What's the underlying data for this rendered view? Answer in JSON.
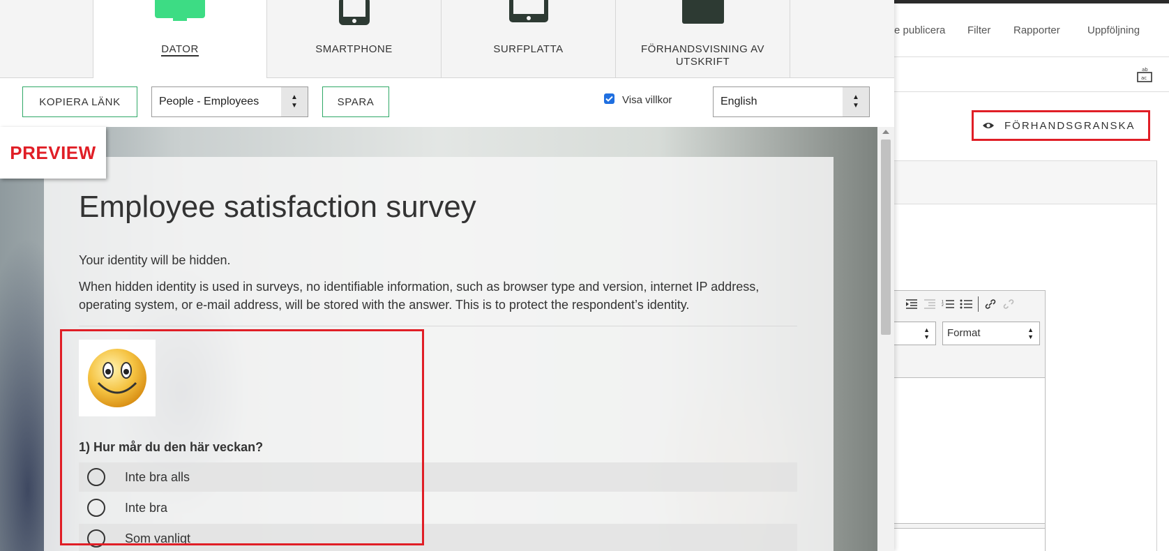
{
  "background_app": {
    "nav": [
      "e publicera",
      "Filter",
      "Rapporter",
      "Uppföljning"
    ],
    "preview_button": {
      "label": "FÖRHANDSGRANSKA",
      "icon": "eye-icon"
    },
    "editor": {
      "format_select": "Format"
    }
  },
  "device_tabs": [
    {
      "label": "DATOR",
      "icon": "desktop-icon",
      "active": true
    },
    {
      "label": "SMARTPHONE",
      "icon": "smartphone-icon",
      "active": false
    },
    {
      "label": "SURFPLATTA",
      "icon": "tablet-icon",
      "active": false
    },
    {
      "label": "FÖRHANDSVISNING AV UTSKRIFT",
      "icon": "print-icon",
      "active": false
    }
  ],
  "toolbar": {
    "copy_link": "KOPIERA LÄNK",
    "audience_select": "People - Employees",
    "save": "SPARA",
    "show_terms": {
      "label": "Visa villkor",
      "checked": true
    },
    "language_select": "English"
  },
  "preview_badge": "PREVIEW",
  "survey": {
    "title": "Employee satisfaction survey",
    "intro_line": "Your identity will be hidden.",
    "intro_paragraph": "When hidden identity is used in surveys, no identifiable information, such as browser type and version, internet IP address, operating system, or e-mail address, will be stored with the answer. This is to protect the respondent’s identity.",
    "image": "smiley-face-image",
    "question": "1) Hur mår du den här veckan?",
    "options": [
      "Inte bra alls",
      "Inte bra",
      "Som vanligt"
    ]
  },
  "colors": {
    "accent_green": "#2fa866",
    "desktop_icon_green": "#3ddc84",
    "highlight_red": "#e01e26",
    "checkbox_blue": "#1f6fe0"
  }
}
